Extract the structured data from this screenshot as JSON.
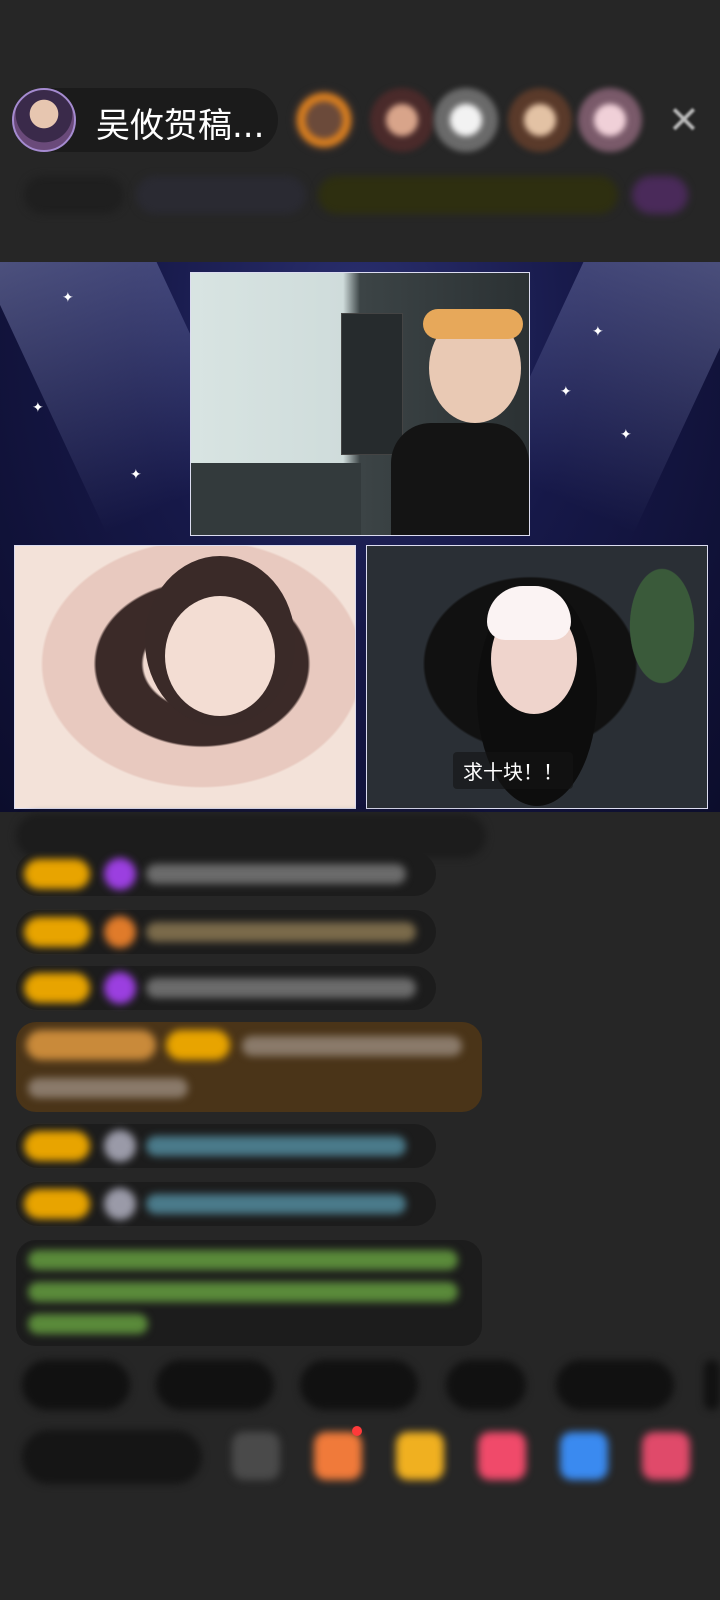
{
  "header": {
    "host_name": "吴攸贺稿...",
    "viewer_avatars": [
      "viewer-avatar-1",
      "viewer-avatar-2",
      "viewer-avatar-3",
      "viewer-avatar-4",
      "viewer-avatar-5"
    ],
    "close_icon": "close-icon"
  },
  "stage": {
    "top_video_overlay": "",
    "right_video_caption": "求十块！！"
  },
  "colors": {
    "background": "#262626",
    "stage_background": "#161848",
    "badge_gold": "#e8a400",
    "highlight_message": "#4a3418"
  },
  "chat": {
    "messages_blurred": true
  },
  "bottom_bar": {
    "quick_buttons_blurred": true,
    "say_something_blurred": true,
    "tools": [
      "emoji-icon",
      "gift-box-icon",
      "treasure-icon",
      "heart-gift-icon",
      "game-icon",
      "red-packet-icon"
    ]
  }
}
